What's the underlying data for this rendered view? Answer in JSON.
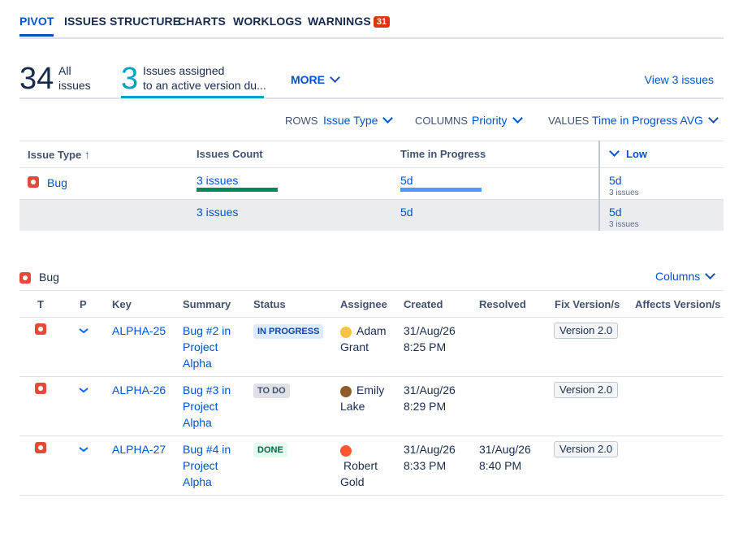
{
  "tabs": {
    "pivot": "PIVOT",
    "structure": "ISSUES STRUCTURE",
    "charts": "CHARTS",
    "worklogs": "WORKLOGS",
    "warnings": "WARNINGS",
    "warnings_count": "31"
  },
  "stats": {
    "all_count": "34",
    "all_label_1": "All",
    "all_label_2": "issues",
    "assigned_count": "3",
    "assigned_label_1": "Issues assigned",
    "assigned_label_2": "to an active version du...",
    "more": "MORE",
    "view": "View 3 issues"
  },
  "controls": {
    "rows_label": "ROWS",
    "rows_value": "Issue Type",
    "columns_label": "COLUMNS",
    "columns_value": "Priority",
    "values_label": "VALUES",
    "values_value": "Time in Progress AVG"
  },
  "pivot": {
    "headers": {
      "issue_type": "Issue Type",
      "issues_count": "Issues Count",
      "time_in_progress": "Time in Progress",
      "low": "Low"
    },
    "rows": [
      {
        "type": "Bug",
        "count": "3 issues",
        "time": "5d",
        "low_value": "5d",
        "low_sub": "3 issues",
        "count_fill": 1.0,
        "time_fill": 1.0
      }
    ],
    "total": {
      "count": "3 issues",
      "time": "5d",
      "low_value": "5d",
      "low_sub": "3 issues"
    },
    "colors": {
      "count_bar": "#00875a",
      "time_bar": "#4c9aff"
    }
  },
  "list": {
    "group": "Bug",
    "columns_button": "Columns",
    "headers": {
      "t": "T",
      "p": "P",
      "key": "Key",
      "summary": "Summary",
      "status": "Status",
      "assignee": "Assignee",
      "created": "Created",
      "resolved": "Resolved",
      "fix": "Fix Version/s",
      "affects": "Affects Version/s"
    },
    "rows": [
      {
        "key": "ALPHA-25",
        "summary": [
          "Bug #2 in",
          "Project",
          "Alpha"
        ],
        "status": "IN PROGRESS",
        "assignee": [
          "Adam",
          "Grant"
        ],
        "created": [
          "31/Aug/26",
          "8:25 PM"
        ],
        "resolved": [
          "",
          ""
        ],
        "fix": "Version 2.0",
        "affects": ""
      },
      {
        "key": "ALPHA-26",
        "summary": [
          "Bug #3 in",
          "Project",
          "Alpha"
        ],
        "status": "TO DO",
        "assignee": [
          "Emily",
          "Lake"
        ],
        "created": [
          "31/Aug/26",
          "8:29 PM"
        ],
        "resolved": [
          "",
          ""
        ],
        "fix": "Version 2.0",
        "affects": ""
      },
      {
        "key": "ALPHA-27",
        "summary": [
          "Bug #4 in",
          "Project",
          "Alpha"
        ],
        "status": "DONE",
        "assignee": [
          "Robert",
          "Gold"
        ],
        "created": [
          "31/Aug/26",
          "8:33 PM"
        ],
        "resolved": [
          "31/Aug/26",
          "8:40 PM"
        ],
        "fix": "Version 2.0",
        "affects": ""
      }
    ],
    "status_colors": {
      "in_progress_bg": "#deebff",
      "in_progress_fg": "#0747a6",
      "todo_bg": "#dfe1e6",
      "todo_fg": "#42526e",
      "done_bg": "#e3fcef",
      "done_fg": "#006644"
    }
  }
}
